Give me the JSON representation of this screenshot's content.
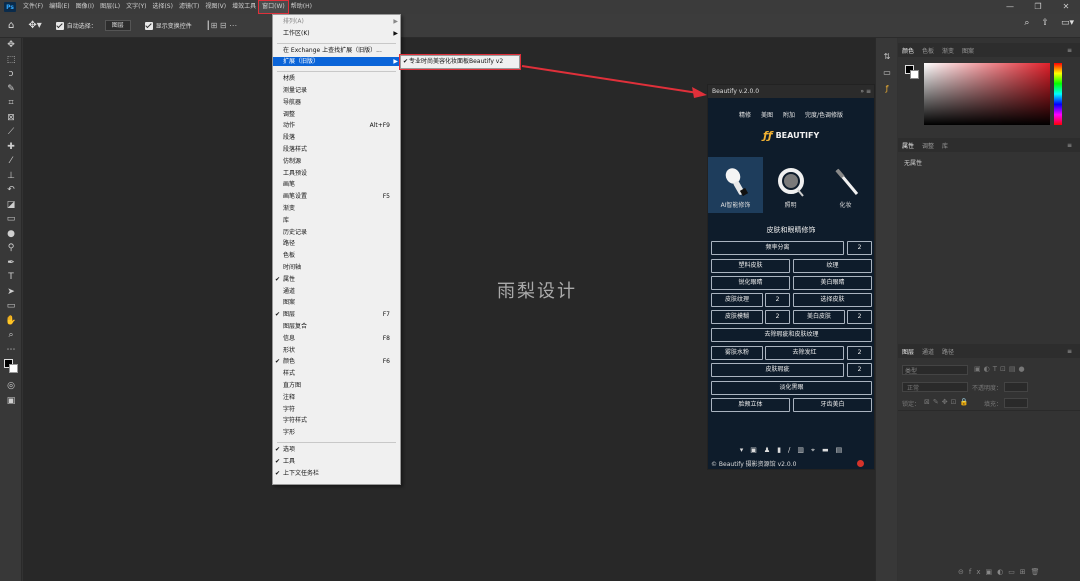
{
  "menubar": {
    "app_icon": "Ps",
    "items": [
      "文件(F)",
      "编辑(E)",
      "图像(I)",
      "图层(L)",
      "文字(Y)",
      "选择(S)",
      "滤镜(T)",
      "视图(V)",
      "增效工具",
      "窗口(W)",
      "帮助(H)"
    ],
    "active_index": 9,
    "window_controls": [
      "—",
      "❐",
      "✕"
    ]
  },
  "options_bar": {
    "auto_select_label": "自动选择：",
    "auto_select_value": "图层",
    "show_transform_label": "显示变换控件"
  },
  "tools": [
    "move-icon",
    "marquee-icon",
    "lasso-icon",
    "quick-select-icon",
    "crop-icon",
    "frame-icon",
    "eyedropper-icon",
    "healing-icon",
    "brush-icon",
    "stamp-icon",
    "history-brush-icon",
    "eraser-icon",
    "gradient-icon",
    "blur-icon",
    "dodge-icon",
    "pen-icon",
    "type-icon",
    "path-select-icon",
    "shape-icon",
    "hand-icon",
    "zoom-icon",
    "more-icon",
    "colors-icon",
    "quickmask-icon",
    "screenmode-icon"
  ],
  "window_menu": {
    "items": [
      {
        "label": "排列(A)",
        "disabled": true,
        "arrow": true
      },
      {
        "label": "工作区(K)",
        "arrow": true
      },
      {
        "sep": true
      },
      {
        "label": "在 Exchange 上查找扩展（旧版）..."
      },
      {
        "label": "扩展（旧版）",
        "arrow": true,
        "highlight": true
      },
      {
        "sep": true
      },
      {
        "label": "材质"
      },
      {
        "label": "测量记录"
      },
      {
        "label": "导航器"
      },
      {
        "label": "调整"
      },
      {
        "label": "动作",
        "shortcut": "Alt+F9"
      },
      {
        "label": "段落"
      },
      {
        "label": "段落样式"
      },
      {
        "label": "仿制源"
      },
      {
        "label": "工具预设"
      },
      {
        "label": "画笔"
      },
      {
        "label": "画笔设置",
        "shortcut": "F5"
      },
      {
        "label": "渐变"
      },
      {
        "label": "库"
      },
      {
        "label": "历史记录"
      },
      {
        "label": "路径"
      },
      {
        "label": "色板"
      },
      {
        "label": "时间轴"
      },
      {
        "label": "属性",
        "checked": true
      },
      {
        "label": "通道"
      },
      {
        "label": "图案"
      },
      {
        "label": "图层",
        "checked": true,
        "shortcut": "F7"
      },
      {
        "label": "图层复合"
      },
      {
        "label": "信息",
        "shortcut": "F8"
      },
      {
        "label": "形状"
      },
      {
        "label": "颜色",
        "checked": true,
        "shortcut": "F6"
      },
      {
        "label": "样式"
      },
      {
        "label": "直方图"
      },
      {
        "label": "注释"
      },
      {
        "label": "字符"
      },
      {
        "label": "字符样式"
      },
      {
        "label": "字形"
      },
      {
        "sep": true
      },
      {
        "label": "选项",
        "checked": true
      },
      {
        "label": "工具",
        "checked": true
      },
      {
        "label": "上下文任务栏",
        "checked": true
      }
    ]
  },
  "submenu": {
    "label": "专业时尚美容化妆面板Beautify v2",
    "checked": true
  },
  "watermark": "雨梨设计",
  "plugin": {
    "title": "Beautify v.2.0.0",
    "header_controls": "» ≡",
    "tabs": [
      "精修",
      "美图",
      "附加",
      "完度/色调修版"
    ],
    "logo_text": "BEAUTIFY",
    "logo_mark": "ƒƒ",
    "cards": [
      {
        "label": "AI智能修饰",
        "icon": "ai-brush-icon",
        "selected": true
      },
      {
        "label": "照明",
        "icon": "light-ring-icon"
      },
      {
        "label": "化妆",
        "icon": "makeup-brush-icon"
      }
    ],
    "section_title": "皮肤和眼睛修饰",
    "buttons": {
      "freq_sep": "频率分离",
      "freq_sep_n": "2",
      "plastic": "塑料皮肤",
      "texture": "纹理",
      "sharpen_eyes": "锐化眼睛",
      "whiten_eyes": "美白眼睛",
      "skin_texture": "皮肤纹理",
      "skin_texture_n": "2",
      "select_skin": "选择皮肤",
      "skin_blur": "皮肤模糊",
      "skin_blur_n": "2",
      "whiten_skin": "美白皮肤",
      "whiten_skin_n": "2",
      "remove_blemish": "去除瑕疵和皮肤纹理",
      "matte": "雾肤水粉",
      "remove_red": "去除发红",
      "remove_red_n": "2",
      "skin_blemish": "皮肤瑕疵",
      "skin_blemish_n": "2",
      "fade_circles": "淡化黑眼",
      "face_3d": "脸颊立体",
      "teeth_white": "牙齿美白"
    },
    "footer_icons": [
      "▾",
      "▣",
      "♟",
      "▮",
      "/",
      "▥",
      "⌖",
      "▬",
      "▤"
    ],
    "footer_text": "© Beautify 摄影资源馆 v2.0.0"
  },
  "dock_icons": [
    "history-icon",
    "comment-icon",
    "plugin-icon"
  ],
  "right_panel": {
    "color_tabs": [
      "颜色",
      "色板",
      "渐变",
      "图案"
    ],
    "props_tabs": [
      "属性",
      "调整",
      "库"
    ],
    "props_empty": "无属性",
    "layers_tabs": [
      "图层",
      "通道",
      "路径"
    ],
    "layers_search": "类型",
    "blend_mode": "正常",
    "opacity_label": "不透明度：",
    "lock_label": "锁定：",
    "fill_label": "填充："
  },
  "colors": {
    "accent_red": "#e0303a",
    "menu_highlight": "#0a64d8",
    "plugin_bg": "#0e1c2b"
  }
}
